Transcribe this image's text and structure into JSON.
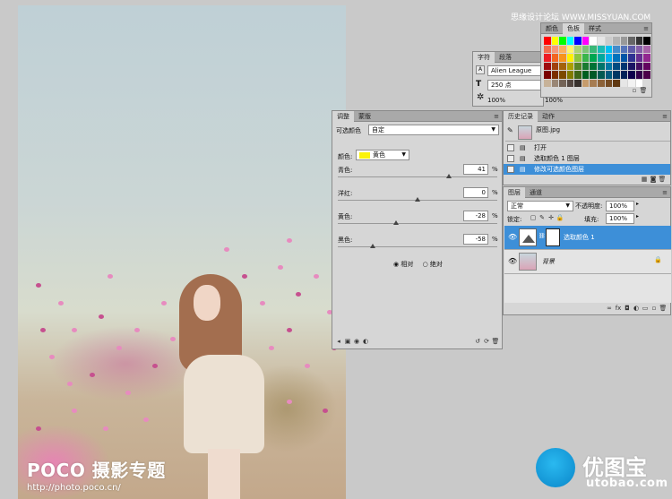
{
  "site_watermark": "思缘设计论坛 WWW.MISSYUAN.COM",
  "photo": {
    "logo": "POCO 摄影专题",
    "url": "http://photo.poco.cn/"
  },
  "character_panel": {
    "tabs": [
      "字符",
      "段落"
    ],
    "font": "Alien League",
    "size": "250 点",
    "scale_left": "100%",
    "scale_right": "100%"
  },
  "swatches_panel": {
    "tabs": [
      "颜色",
      "色板",
      "样式"
    ],
    "colors": [
      "#ff0000",
      "#ffff00",
      "#00ff00",
      "#00ffff",
      "#0000ff",
      "#ff00ff",
      "#ffffff",
      "#e6e6e6",
      "#cccccc",
      "#b3b3b3",
      "#999999",
      "#666666",
      "#333333",
      "#000000",
      "#f26c4f",
      "#f69679",
      "#fbaf5d",
      "#fff568",
      "#acd373",
      "#7cc576",
      "#3bb878",
      "#1abbb4",
      "#00bff3",
      "#438ccb",
      "#5574b9",
      "#605ca8",
      "#855fa8",
      "#a763a8",
      "#ed1c24",
      "#f26522",
      "#f7941d",
      "#fff200",
      "#8dc63f",
      "#39b54a",
      "#00a651",
      "#00a99d",
      "#00aeef",
      "#0072bc",
      "#0054a6",
      "#2e3192",
      "#662d91",
      "#92278f",
      "#9e0b0f",
      "#a0410d",
      "#a36209",
      "#aba000",
      "#598527",
      "#1a7b30",
      "#007236",
      "#00746b",
      "#0076a3",
      "#004b80",
      "#003471",
      "#1b1464",
      "#440e62",
      "#630460",
      "#790000",
      "#7b2e00",
      "#7d4900",
      "#827b00",
      "#406618",
      "#005e20",
      "#005826",
      "#005952",
      "#005b7f",
      "#003663",
      "#002157",
      "#0d004c",
      "#32004b",
      "#4b0049",
      "#c7b299",
      "#998675",
      "#736357",
      "#534741",
      "#37302d",
      "#c69c6d",
      "#a67c52",
      "#8c6239",
      "#754c24",
      "#603913",
      "#e6e6e6",
      "#f2f2f2",
      "#ffffff",
      "#d9d9d9"
    ]
  },
  "adjustments_panel": {
    "tabs": [
      "调整",
      "蒙版"
    ],
    "preset_label": "可选颜色",
    "preset_value": "自定",
    "color_label": "颜色:",
    "color_value": "黄色",
    "sliders": [
      {
        "label": "青色:",
        "value": "41",
        "pct": "%",
        "level": 41
      },
      {
        "label": "洋红:",
        "value": "0",
        "pct": "%",
        "level": 0
      },
      {
        "label": "黄色:",
        "value": "-28",
        "pct": "%",
        "level": -28
      },
      {
        "label": "黑色:",
        "value": "-58",
        "pct": "%",
        "level": -58
      }
    ],
    "mode_relative": "相对",
    "mode_absolute": "绝对",
    "mode_selected": "相对"
  },
  "history_panel": {
    "tabs": [
      "历史记录",
      "动作"
    ],
    "snapshot": "原图.jpg",
    "items": [
      "打开",
      "选取颜色 1 图层",
      "修改可选颜色图层"
    ],
    "active_index": 2
  },
  "layers_panel": {
    "tabs": [
      "图层",
      "通道"
    ],
    "blend_mode": "正常",
    "opacity_label": "不透明度:",
    "opacity_value": "100%",
    "lock_label": "锁定:",
    "fill_label": "填充:",
    "fill_value": "100%",
    "layers": [
      {
        "name": "选取颜色 1",
        "active": true
      },
      {
        "name": "背景",
        "active": false
      }
    ]
  },
  "brand": {
    "title": "优图宝",
    "url": "utobao.com"
  },
  "colors": {
    "selection_blue": "#3d8fd8",
    "panel_gray": "#d6d6d6",
    "workspace_gray": "#c9c9c9"
  }
}
